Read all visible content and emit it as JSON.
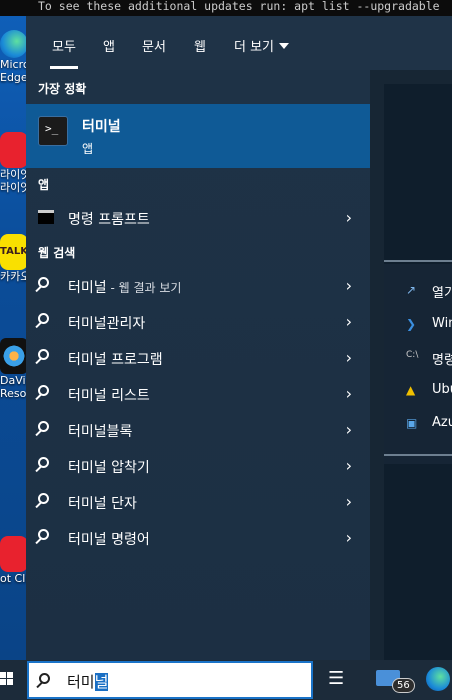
{
  "terminal": {
    "text": "To see these additional updates run: apt list --upgradable"
  },
  "desktop_icons": [
    {
      "label": "Micros",
      "label2": "Edge"
    },
    {
      "label": "라이엇",
      "label2": "라이엇"
    },
    {
      "label": "카카오톡"
    },
    {
      "label": "DaVin",
      "label2": "Resolv"
    },
    {
      "label": "ot Cli"
    }
  ],
  "tabs": [
    "모두",
    "앱",
    "문서",
    "웹",
    "더 보기"
  ],
  "sections": {
    "best_match": "가장 정확",
    "apps": "앱",
    "web": "웹 검색"
  },
  "best_match": {
    "title": "터미널",
    "subtitle": "앱"
  },
  "apps": [
    {
      "label": "명령 프롬프트"
    }
  ],
  "web_results": [
    {
      "label": "터미널",
      "suffix": " - 웹 결과 보기"
    },
    {
      "label": "터미널관리자",
      "suffix": ""
    },
    {
      "label": "터미널 프로그램",
      "suffix": ""
    },
    {
      "label": "터미널 리스트",
      "suffix": ""
    },
    {
      "label": "터미널블록",
      "suffix": ""
    },
    {
      "label": "터미널 압착기",
      "suffix": ""
    },
    {
      "label": "터미널 단자",
      "suffix": ""
    },
    {
      "label": "터미널 명령어",
      "suffix": ""
    }
  ],
  "right_actions": [
    {
      "label": "열기",
      "icon": "open-icon"
    },
    {
      "label": "Win",
      "icon": "powershell-icon"
    },
    {
      "label": "명령",
      "icon": "cmd-icon"
    },
    {
      "label": "Ubu",
      "icon": "linux-icon"
    },
    {
      "label": "Azu",
      "icon": "azure-cloud-shell-icon"
    }
  ],
  "search": {
    "query_prefix": "터미",
    "query_selected": "널"
  },
  "taskbar": {
    "mail_badge": "56"
  },
  "colors": {
    "accent": "#0f5a96",
    "panel": "#1f3347"
  }
}
